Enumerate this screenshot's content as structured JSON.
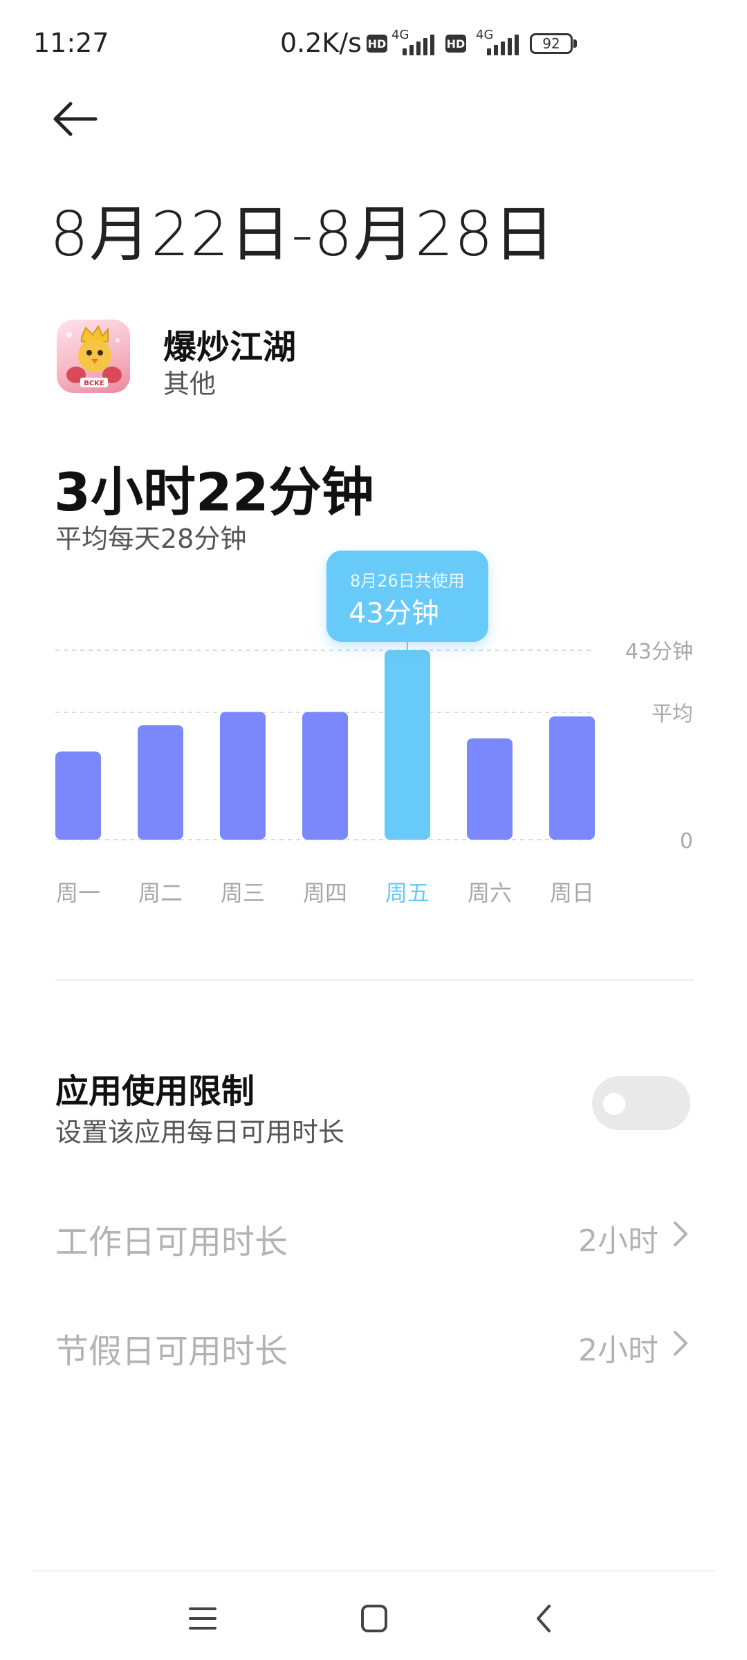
{
  "status_bar": {
    "time": "11:27",
    "net_speed": "0.2K/s",
    "hd": "HD",
    "network": "4G",
    "battery": "92"
  },
  "title": "8月22日-8月28日",
  "app": {
    "name": "爆炒江湖",
    "category": "其他",
    "icon": "app-icon-chick-with-crown",
    "icon_text": "BCKE"
  },
  "summary": {
    "total": "3小时22分钟",
    "daily_average": "平均每天28分钟"
  },
  "chart_data": {
    "type": "bar",
    "categories": [
      "周一",
      "周二",
      "周三",
      "周四",
      "周五",
      "周六",
      "周日"
    ],
    "values": [
      20,
      26,
      29,
      29,
      43,
      23,
      28
    ],
    "highlight_index": 4,
    "y_labels": {
      "max": "43分钟",
      "avg": "平均",
      "zero": "0"
    },
    "average_value": 28.9,
    "ylim": [
      0,
      43
    ],
    "tooltip": {
      "title": "8月26日共使用",
      "value": "43分钟"
    },
    "colors": {
      "bar": "#7b88fb",
      "highlight": "#67caf9",
      "grid": "#dcdcdc",
      "label": "#a8a8a8"
    }
  },
  "limit": {
    "title": "应用使用限制",
    "subtitle": "设置该应用每日可用时长",
    "enabled": false
  },
  "rows": [
    {
      "label": "工作日可用时长",
      "value": "2小时"
    },
    {
      "label": "节假日可用时长",
      "value": "2小时"
    }
  ],
  "nav": [
    "menu-icon",
    "home-icon",
    "back-icon"
  ]
}
